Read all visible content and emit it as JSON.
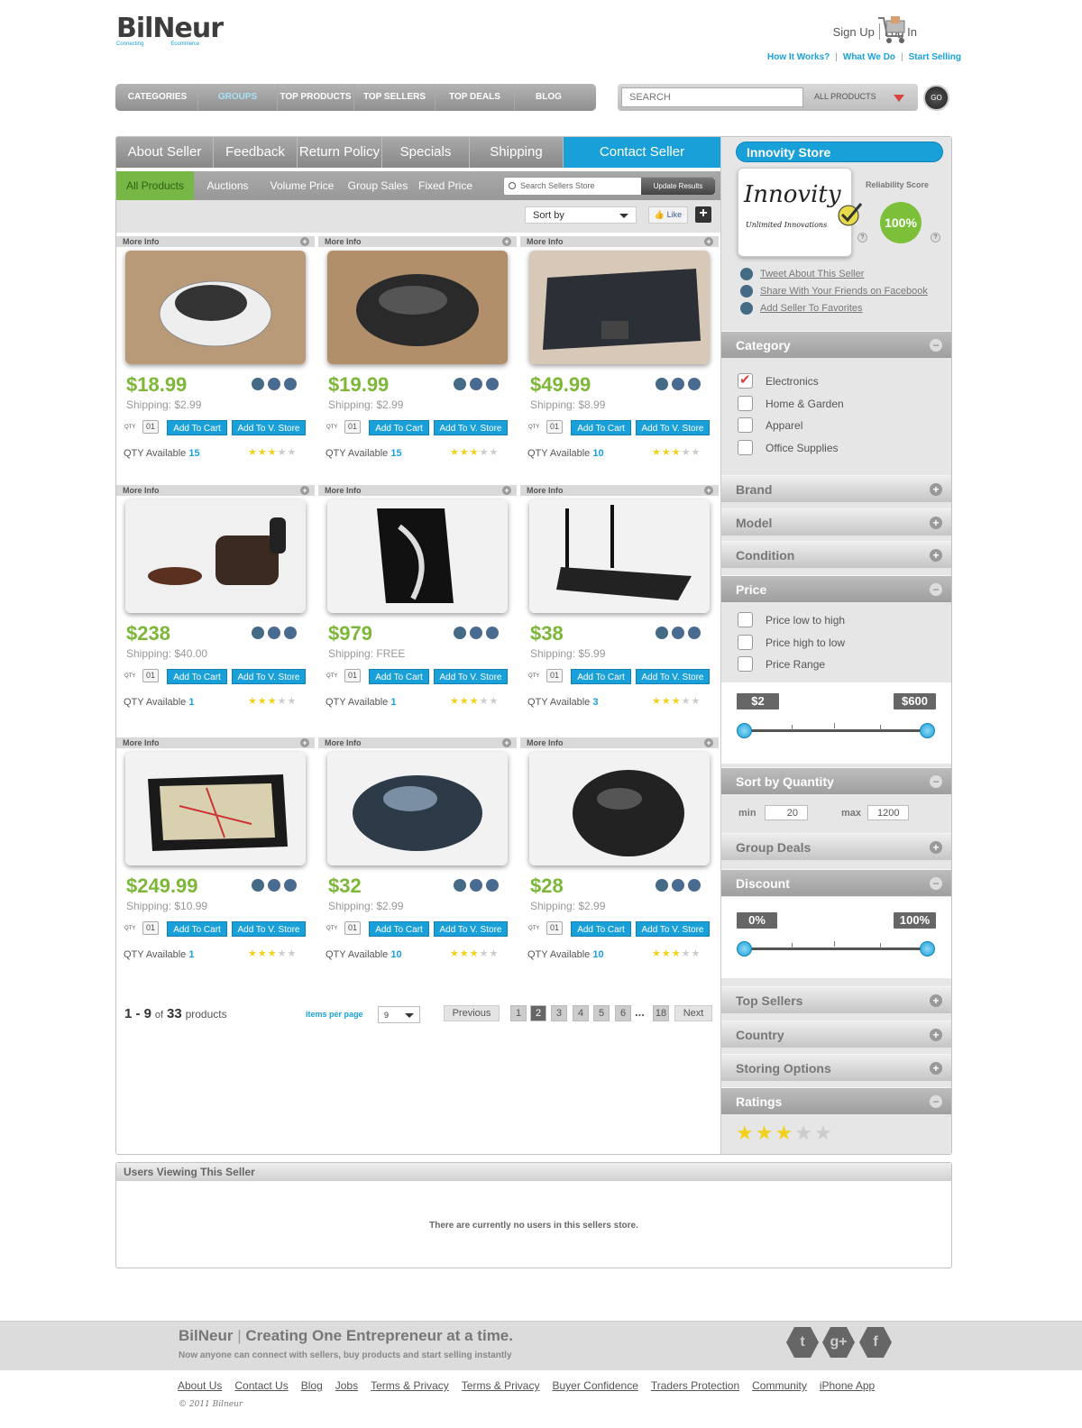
{
  "brand": {
    "name": "BilNeur",
    "tag_left": "Connecting",
    "tag_right": "Ecommerce"
  },
  "header": {
    "signup": "Sign Up",
    "login": "Log In",
    "links": [
      "How It Works?",
      "What We Do",
      "Start Selling"
    ],
    "link_sep": "|"
  },
  "nav": {
    "items": [
      "CATEGORIES",
      "GROUPS",
      "TOP PRODUCTS",
      "TOP SELLERS",
      "TOP DEALS",
      "BLOG"
    ],
    "active": "GROUPS"
  },
  "search": {
    "placeholder": "SEARCH",
    "scope": "ALL PRODUCTS",
    "go": "GO"
  },
  "tabs": [
    "About Seller",
    "Feedback",
    "Return Policy",
    "Specials",
    "Shipping",
    "Contact Seller"
  ],
  "filters": [
    "All Products",
    "Auctions",
    "Volume Price",
    "Group Sales",
    "Fixed Price"
  ],
  "store_search": {
    "placeholder": "Search Sellers Store",
    "button": "Update Results"
  },
  "sort": {
    "label": "Sort by",
    "like": "Like",
    "plus": "+"
  },
  "product_common": {
    "more_info": "More Info",
    "qty_label": "QTY",
    "qty_value": "01",
    "add_cart": "Add To Cart",
    "add_store": "Add To V. Store",
    "available_label": "QTY Available"
  },
  "products": [
    {
      "price": "$18.99",
      "shipping": "Shipping: $2.99",
      "available": "15",
      "rating": 3,
      "image": "white-mouse"
    },
    {
      "price": "$19.99",
      "shipping": "Shipping: $2.99",
      "available": "15",
      "rating": 3,
      "image": "black-mouse"
    },
    {
      "price": "$49.99",
      "shipping": "Shipping: $8.99",
      "available": "10",
      "rating": 3,
      "image": "keyboard"
    },
    {
      "price": "$238",
      "shipping": "Shipping: $40.00",
      "available": "1",
      "rating": 3,
      "image": "lounge-chair"
    },
    {
      "price": "$979",
      "shipping": "Shipping: FREE",
      "available": "1",
      "rating": 3,
      "image": "software-box"
    },
    {
      "price": "$38",
      "shipping": "Shipping: $5.99",
      "available": "3",
      "rating": 3,
      "image": "router"
    },
    {
      "price": "$249.99",
      "shipping": "Shipping: $10.99",
      "available": "1",
      "rating": 3,
      "image": "gps"
    },
    {
      "price": "$32",
      "shipping": "Shipping: $2.99",
      "available": "10",
      "rating": 3,
      "image": "logitech-mouse"
    },
    {
      "price": "$28",
      "shipping": "Shipping: $2.99",
      "available": "10",
      "rating": 3,
      "image": "gaming-mouse"
    }
  ],
  "pagination": {
    "range": "1 - 9",
    "of": "of",
    "total": "33",
    "products": "products",
    "ipp_label": "items per page",
    "ipp_value": "9",
    "previous": "Previous",
    "pages": [
      "1",
      "2",
      "3",
      "4",
      "5",
      "6"
    ],
    "current": "2",
    "ellipsis": "...",
    "last": "18",
    "next": "Next"
  },
  "seller": {
    "store_name": "Innovity Store",
    "logo_name": "Innovity",
    "logo_slogan": "Unlimited Innovations",
    "reliability_label": "Reliability Score",
    "reliability_value": "100%",
    "q": "?",
    "links": [
      "Tweet About This Seller",
      "Share With Your Friends on Facebook",
      "Add Seller To Favorites"
    ]
  },
  "sidebar": {
    "category": {
      "title": "Category",
      "items": [
        {
          "label": "Electronics",
          "checked": true
        },
        {
          "label": "Home & Garden",
          "checked": false
        },
        {
          "label": "Apparel",
          "checked": false
        },
        {
          "label": "Office Supplies",
          "checked": false
        }
      ]
    },
    "brand": "Brand",
    "model": "Model",
    "condition": "Condition",
    "price": {
      "title": "Price",
      "options": [
        "Price low to high",
        "Price high to low",
        "Price Range"
      ],
      "min": "$2",
      "max": "$600"
    },
    "quantity": {
      "title": "Sort by Quantity",
      "min_label": "min",
      "min": "20",
      "max_label": "max",
      "max": "1200"
    },
    "group_deals": "Group Deals",
    "discount": {
      "title": "Discount",
      "min": "0%",
      "max": "100%"
    },
    "top_sellers": "Top Sellers",
    "country": "Country",
    "storing": "Storing Options",
    "ratings": {
      "title": "Ratings",
      "value": 3,
      "max": 5
    }
  },
  "users": {
    "title": "Users Viewing This Seller",
    "message": "There are currently no users in this sellers store."
  },
  "footer": {
    "brand": "BilNeur",
    "sep": "|",
    "tagline": "Creating One Entrepreneur at a time.",
    "sub": "Now anyone can connect with sellers, buy products and start selling instantly",
    "social": [
      "twitter-icon",
      "google-plus-icon",
      "facebook-icon"
    ],
    "links": [
      "About Us",
      "Contact Us",
      "Blog",
      "Jobs",
      "Terms & Privacy",
      "Terms & Privacy",
      "Buyer Confidence",
      "Traders Protection",
      "Community",
      "iPhone App"
    ],
    "copyright": "© 2011 Bilneur"
  },
  "colors": {
    "accent": "#19a0d8",
    "price": "#7cb737",
    "active_filter": "#76b746",
    "reliability": "#7cc03a"
  }
}
